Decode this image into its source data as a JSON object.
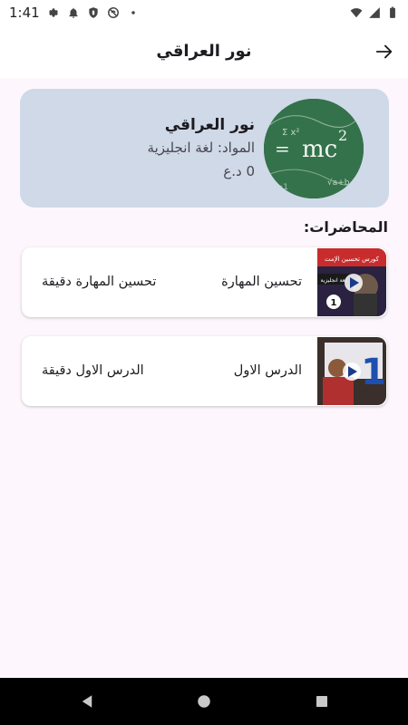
{
  "status_bar": {
    "time": "1:41",
    "left_icons": [
      "settings-icon",
      "notification-bell-icon",
      "shield-icon",
      "do-not-disturb-icon",
      "dot-icon"
    ],
    "right_icons": [
      "wifi-icon",
      "cellular-signal-icon",
      "battery-icon"
    ]
  },
  "app_bar": {
    "title": "نور العراقي",
    "back_icon": "arrow-right-icon"
  },
  "profile": {
    "name": "نور العراقي",
    "subject": "المواد: لغة انجليزية",
    "balance": "0 د.ع",
    "colors": {
      "card_bg": "#cfd9e8"
    }
  },
  "lectures_section": {
    "title": "المحاضرات:",
    "items": [
      {
        "title": "تحسين المهارة",
        "duration": "تحسين المهارة دقيقة",
        "thumb_badge": "1"
      },
      {
        "title": "الدرس الاول",
        "duration": "الدرس الاول دقيقة",
        "thumb_badge": "1"
      }
    ]
  },
  "nav_bar": {
    "buttons": [
      "back-triangle-icon",
      "home-circle-icon",
      "recents-square-icon"
    ]
  }
}
